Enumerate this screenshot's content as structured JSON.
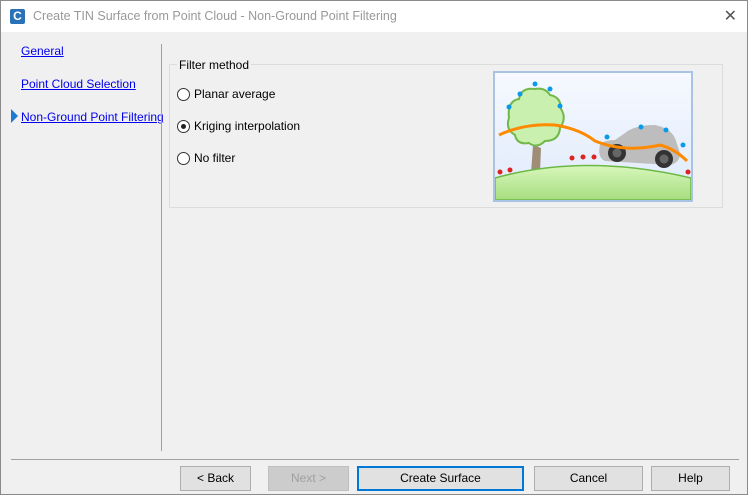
{
  "window": {
    "title": "Create TIN Surface from Point Cloud - Non-Ground Point Filtering",
    "app_icon": "C"
  },
  "nav": {
    "items": [
      {
        "label": "General"
      },
      {
        "label": "Point Cloud Selection"
      },
      {
        "label": "Non-Ground Point Filtering",
        "active": true
      }
    ]
  },
  "filter": {
    "group_label": "Filter method",
    "options": [
      {
        "label": "Planar average",
        "selected": false
      },
      {
        "label": "Kriging interpolation",
        "selected": true
      },
      {
        "label": "No filter",
        "selected": false
      }
    ]
  },
  "buttons": {
    "back": "< Back",
    "next": "Next >",
    "create": "Create Surface",
    "cancel": "Cancel",
    "help": "Help"
  }
}
